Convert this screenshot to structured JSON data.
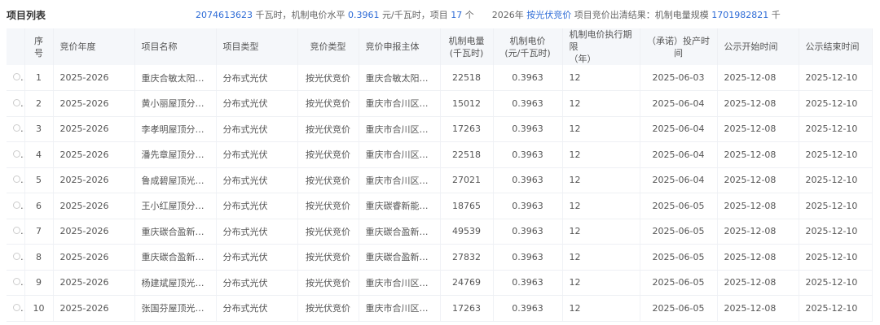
{
  "title": "项目列表",
  "marquee": {
    "p1": "2074613623",
    "p2": " 千瓦时，机制电价水平 ",
    "p3": "0.3961",
    "p4": " 元/千瓦时，项目 ",
    "p5": "17",
    "p6": " 个",
    "p7": "2026年 ",
    "p8": "按光伏竞价",
    "p9": " 项目竞价出清结果：机制电量规模 ",
    "p10": "1701982821",
    "p11": " 千"
  },
  "columns": [
    "序号",
    "竞价年度",
    "项目名称",
    "项目类型",
    "竞价类型",
    "竞价申报主体",
    "机制电量\n(千瓦时)",
    "机制电价\n(元/千瓦时)",
    "机制电价执行期限\n（年）",
    "（承诺）投产时间",
    "公示开始时间",
    "公示结束时间"
  ],
  "rows": [
    [
      "1",
      "2025-2026",
      "重庆合敏太阳能...",
      "分布式光伏",
      "按光伏竞价",
      "重庆合敏太阳能...",
      "22518",
      "0.3963",
      "12",
      "2025-06-03",
      "2025-12-08",
      "2025-12-10"
    ],
    [
      "2",
      "2025-2026",
      "黄小丽屋顶分布...",
      "分布式光伏",
      "按光伏竞价",
      "重庆市合川区沛...",
      "15012",
      "0.3963",
      "12",
      "2025-06-04",
      "2025-12-08",
      "2025-12-10"
    ],
    [
      "3",
      "2025-2026",
      "李孝明屋顶分布...",
      "分布式光伏",
      "按光伏竞价",
      "重庆市合川区沛...",
      "17263",
      "0.3963",
      "12",
      "2025-06-04",
      "2025-12-08",
      "2025-12-10"
    ],
    [
      "4",
      "2025-2026",
      "潘先章屋顶分布...",
      "分布式光伏",
      "按光伏竞价",
      "重庆市合川区沛...",
      "22518",
      "0.3963",
      "12",
      "2025-06-04",
      "2025-12-08",
      "2025-12-10"
    ],
    [
      "5",
      "2025-2026",
      "鲁成碧屋顶光伏...",
      "分布式光伏",
      "按光伏竞价",
      "重庆市合川区沛...",
      "27021",
      "0.3963",
      "12",
      "2025-06-04",
      "2025-12-08",
      "2025-12-10"
    ],
    [
      "6",
      "2025-2026",
      "王小红屋顶分布...",
      "分布式光伏",
      "按光伏竞价",
      "重庆碳睿新能源...",
      "18765",
      "0.3963",
      "12",
      "2025-06-05",
      "2025-12-08",
      "2025-12-10"
    ],
    [
      "7",
      "2025-2026",
      "重庆碳合盈新能...",
      "分布式光伏",
      "按光伏竞价",
      "重庆碳合盈新能...",
      "49539",
      "0.3963",
      "12",
      "2025-06-05",
      "2025-12-08",
      "2025-12-10"
    ],
    [
      "8",
      "2025-2026",
      "重庆碳合盈新能...",
      "分布式光伏",
      "按光伏竞价",
      "重庆碳合盈新能...",
      "27832",
      "0.3963",
      "12",
      "2025-06-05",
      "2025-12-08",
      "2025-12-10"
    ],
    [
      "9",
      "2025-2026",
      "杨建斌屋顶光伏...",
      "分布式光伏",
      "按光伏竞价",
      "重庆市合川区沛...",
      "24769",
      "0.3963",
      "12",
      "2025-06-05",
      "2025-12-08",
      "2025-12-10"
    ],
    [
      "10",
      "2025-2026",
      "张国芬屋顶光伏...",
      "分布式光伏",
      "按光伏竞价",
      "重庆市合川区沛...",
      "17263",
      "0.3963",
      "12",
      "2025-06-05",
      "2025-12-08",
      "2025-12-10"
    ]
  ]
}
